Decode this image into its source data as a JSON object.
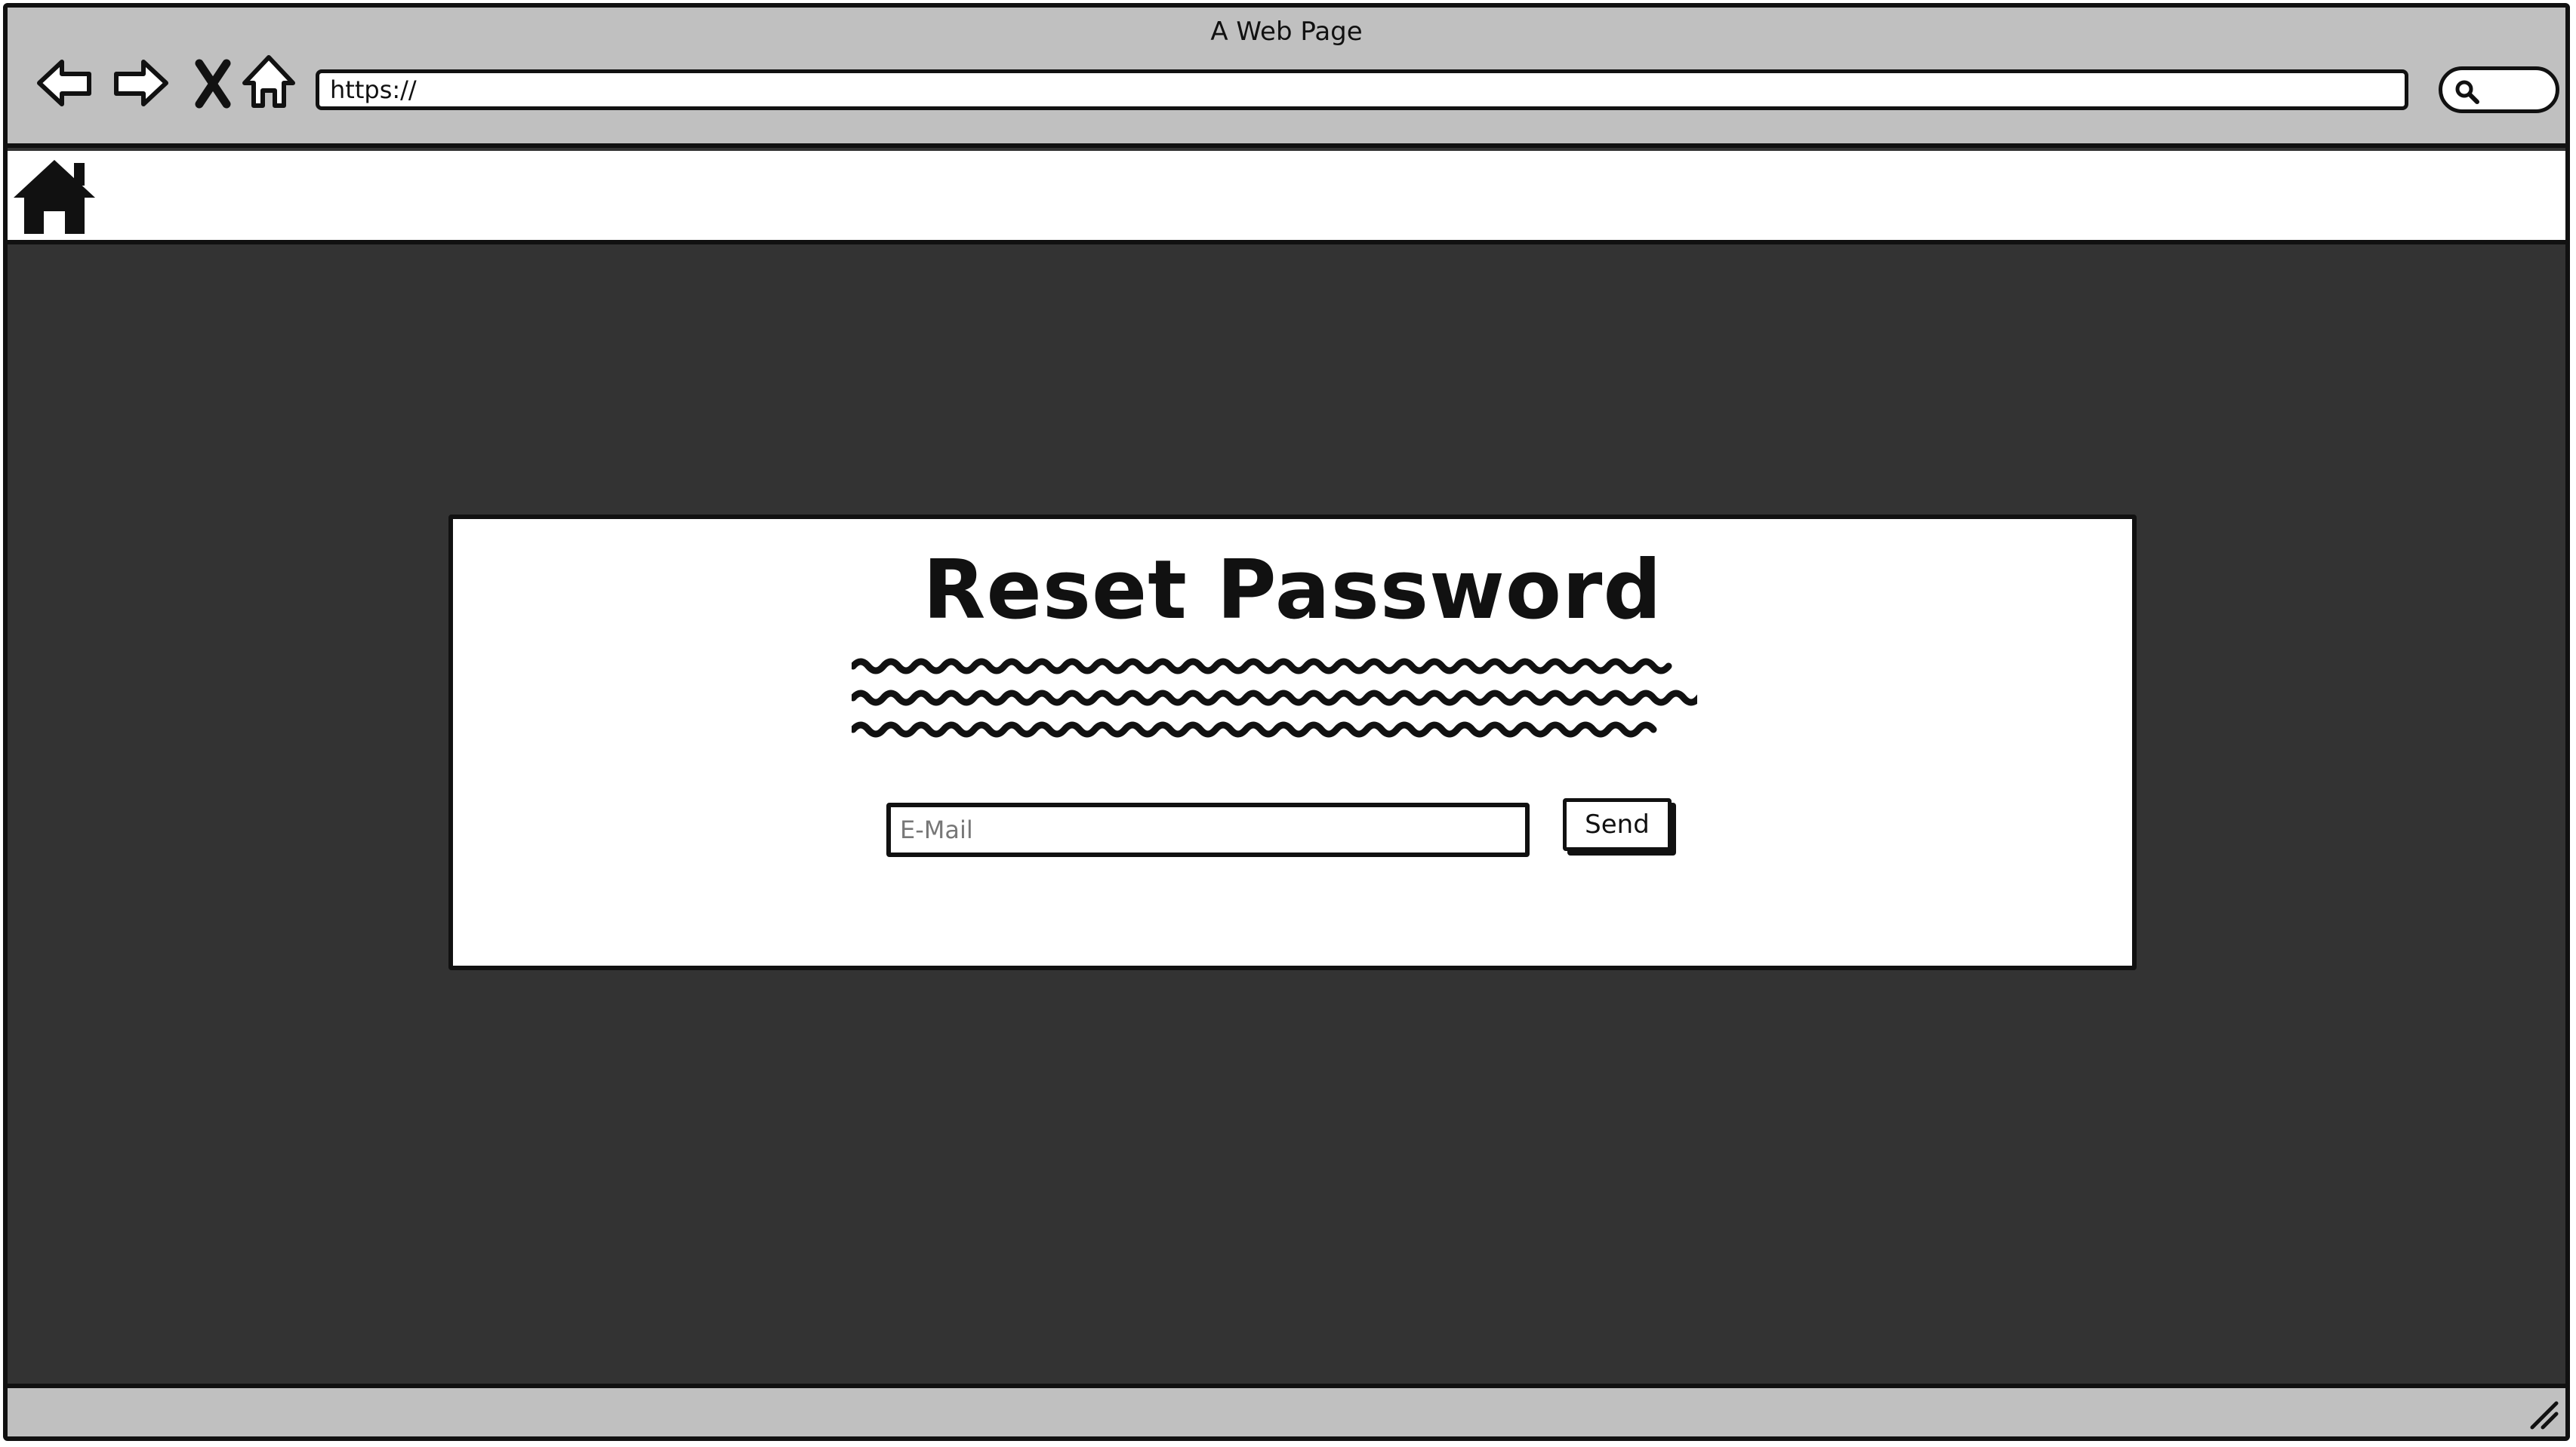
{
  "window": {
    "title": "A Web Page"
  },
  "toolbar": {
    "back_icon": "arrow-left-icon",
    "forward_icon": "arrow-right-icon",
    "stop_icon": "close-icon",
    "home_icon": "home-outline-icon",
    "url": "https://",
    "search_icon": "search-icon"
  },
  "site_header": {
    "logo_icon": "home-filled-icon"
  },
  "reset_form": {
    "title": "Reset Password",
    "email_placeholder": "E-Mail",
    "send_label": "Send"
  },
  "status_bar": {
    "resize_icon": "resize-grip-icon"
  },
  "colors": {
    "chrome": "#c0c0c0",
    "page_background": "#333333",
    "card": "#ffffff",
    "stroke": "#111111"
  }
}
